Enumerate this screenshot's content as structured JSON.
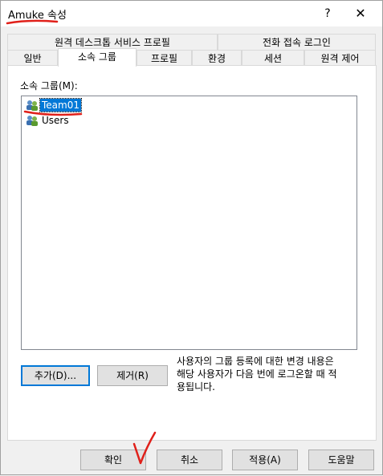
{
  "window": {
    "title": "Amuke 속성",
    "help_label": "?",
    "close_label": "✕"
  },
  "tabs_row1": [
    "원격 데스크톱 서비스 프로필",
    "전화 접속 로그인"
  ],
  "tabs_row2": [
    "일반",
    "소속 그룹",
    "프로필",
    "환경",
    "세션",
    "원격 제어"
  ],
  "selected_tab": "소속 그룹",
  "panel": {
    "groups_label": "소속 그룹(M):",
    "groups": [
      {
        "name": "Team01",
        "selected": true
      },
      {
        "name": "Users",
        "selected": false
      }
    ],
    "add_button": "추가(D)...",
    "remove_button": "제거(R)",
    "note_lines": [
      "사용자의 그룹 등록에 대한 변경 내용은",
      "해당 사용자가 다음 번에 로그온할 때 적",
      "용됩니다."
    ]
  },
  "footer": {
    "ok": "확인",
    "cancel": "취소",
    "apply": "적용(A)",
    "help": "도움말"
  },
  "colors": {
    "selection": "#0078d7",
    "annotation": "#e0201a"
  }
}
